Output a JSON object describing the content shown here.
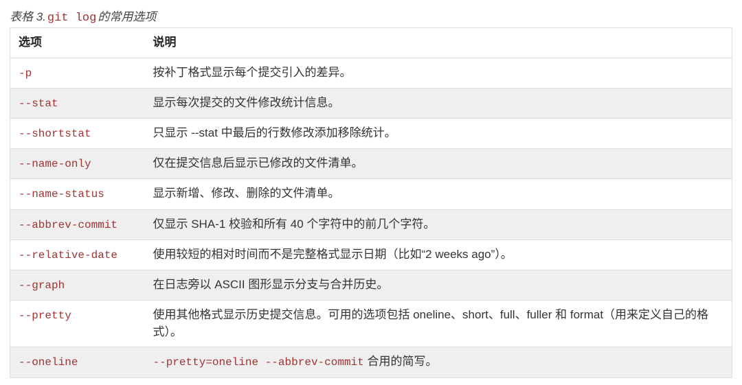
{
  "caption": {
    "prefix": "表格 3.",
    "command": "git log",
    "suffix": "的常用选项"
  },
  "headers": {
    "option": "选项",
    "description": "说明"
  },
  "rows": [
    {
      "option": "-p",
      "description": "按补丁格式显示每个提交引入的差异。"
    },
    {
      "option": "--stat",
      "description": "显示每次提交的文件修改统计信息。"
    },
    {
      "option": "--shortstat",
      "description": "只显示 --stat 中最后的行数修改添加移除统计。"
    },
    {
      "option": "--name-only",
      "description": "仅在提交信息后显示已修改的文件清单。"
    },
    {
      "option": "--name-status",
      "description": "显示新增、修改、删除的文件清单。"
    },
    {
      "option": "--abbrev-commit",
      "description": "仅显示 SHA-1 校验和所有 40 个字符中的前几个字符。"
    },
    {
      "option": "--relative-date",
      "description": "使用较短的相对时间而不是完整格式显示日期（比如“2 weeks ago”）。"
    },
    {
      "option": "--graph",
      "description": "在日志旁以 ASCII 图形显示分支与合并历史。"
    },
    {
      "option": "--pretty",
      "description": "使用其他格式显示历史提交信息。可用的选项包括 oneline、short、full、fuller 和 format（用来定义自己的格式）。"
    },
    {
      "option": "--oneline",
      "desc_prefix": "",
      "inline_code": "--pretty=oneline --abbrev-commit",
      "desc_suffix": " 合用的简写。"
    }
  ]
}
